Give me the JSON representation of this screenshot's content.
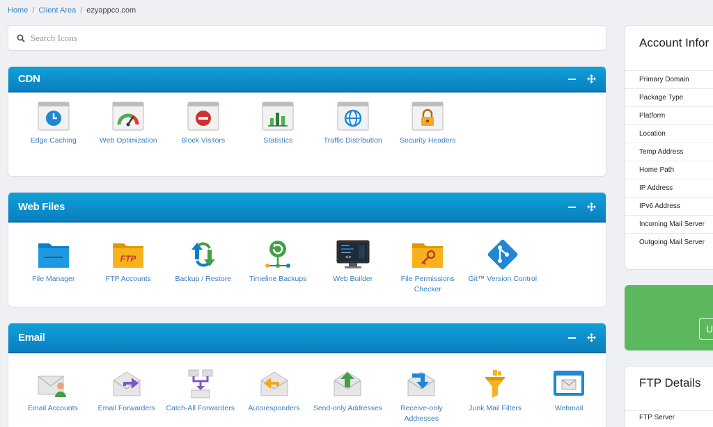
{
  "breadcrumb": {
    "home": "Home",
    "sep": "/",
    "client_area": "Client Area",
    "current": "ezyappco.com"
  },
  "search": {
    "placeholder": "Search Icons"
  },
  "panels": [
    {
      "title": "CDN",
      "items": [
        {
          "label": "Edge Caching",
          "icon": "edge-caching-icon"
        },
        {
          "label": "Web Optimization",
          "icon": "web-optimization-icon"
        },
        {
          "label": "Block Visitors",
          "icon": "block-visitors-icon"
        },
        {
          "label": "Statistics",
          "icon": "statistics-icon"
        },
        {
          "label": "Traffic Distribution",
          "icon": "traffic-distribution-icon"
        },
        {
          "label": "Security Headers",
          "icon": "security-headers-icon"
        }
      ]
    },
    {
      "title": "Web Files",
      "items": [
        {
          "label": "File Manager",
          "icon": "file-manager-icon"
        },
        {
          "label": "FTP Accounts",
          "icon": "ftp-accounts-icon"
        },
        {
          "label": "Backup / Restore",
          "icon": "backup-restore-icon"
        },
        {
          "label": "Timeline Backups",
          "icon": "timeline-backups-icon"
        },
        {
          "label": "Web Builder",
          "icon": "web-builder-icon"
        },
        {
          "label": "File Permissions Checker",
          "icon": "file-permissions-icon"
        },
        {
          "label": "Git™ Version Control",
          "icon": "git-icon"
        }
      ]
    },
    {
      "title": "Email",
      "items": [
        {
          "label": "Email Accounts",
          "icon": "email-accounts-icon"
        },
        {
          "label": "Email Forwarders",
          "icon": "email-forwarders-icon"
        },
        {
          "label": "Catch-All Forwarders",
          "icon": "catch-all-icon"
        },
        {
          "label": "Autoresponders",
          "icon": "autoresponders-icon"
        },
        {
          "label": "Send-only Addresses",
          "icon": "send-only-icon"
        },
        {
          "label": "Receive-only Addresses",
          "icon": "receive-only-icon"
        },
        {
          "label": "Junk Mail Filters",
          "icon": "junk-filter-icon"
        },
        {
          "label": "Webmail",
          "icon": "webmail-icon"
        }
      ]
    }
  ],
  "account": {
    "title": "Account Infor",
    "rows": [
      "Primary Domain",
      "Package Type",
      "Platform",
      "Location",
      "Temp Address",
      "Home Path",
      "IP Address",
      "IPv6 Address",
      "Incoming Mail Server",
      "Outgoing Mail Server"
    ]
  },
  "upgrade": {
    "button": "U"
  },
  "ftp": {
    "title": "FTP Details",
    "rows": [
      "FTP Server"
    ]
  },
  "colors": {
    "header_blue": "#0a8cd0",
    "link_blue": "#3a7fbf",
    "green": "#5cb85c"
  }
}
